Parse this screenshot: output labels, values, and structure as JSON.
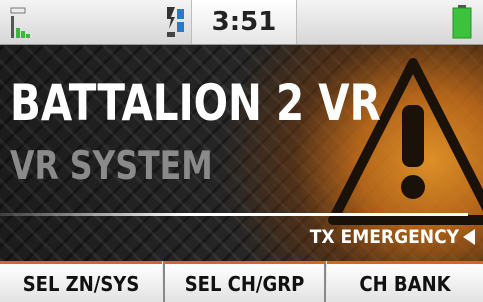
{
  "status_bar": {
    "signal_icon": "signal-strength-icon",
    "channel_icon": "channel-scan-icon",
    "time": "3:51",
    "battery_icon": "battery-full-icon",
    "battery_color": "#3cc23c"
  },
  "main": {
    "title": "BATTALION 2 VR",
    "subtitle": "VR SYSTEM",
    "tx_status": "TX EMERGENCY",
    "background_icon": "warning-triangle-icon",
    "accent_color": "#e08a2a"
  },
  "softkeys": [
    {
      "label": "SEL ZN/SYS"
    },
    {
      "label": "SEL CH/GRP"
    },
    {
      "label": "CH BANK"
    }
  ],
  "colors": {
    "softkey_border": "#e0602a",
    "title": "#ffffff",
    "subtitle": "#8a8a8a"
  }
}
